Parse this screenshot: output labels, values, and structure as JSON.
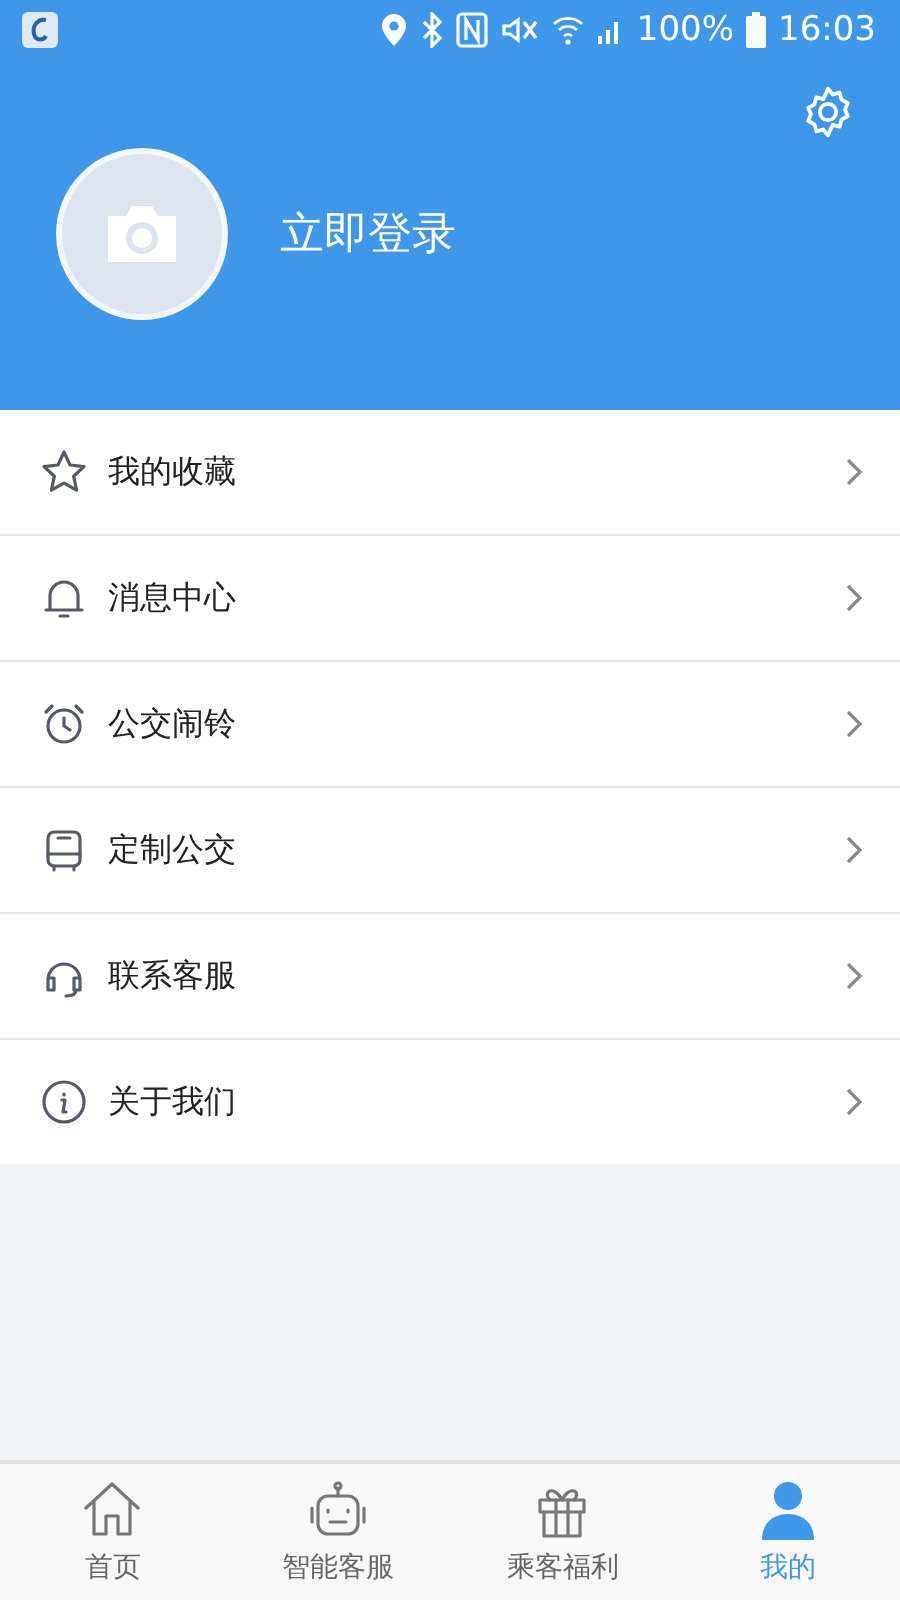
{
  "status_bar": {
    "battery": "100%",
    "time": "16:03"
  },
  "profile": {
    "login_label": "立即登录"
  },
  "menu": [
    {
      "kind": "star",
      "label": "我的收藏"
    },
    {
      "kind": "bell",
      "label": "消息中心"
    },
    {
      "kind": "alarm",
      "label": "公交闹铃"
    },
    {
      "kind": "bus",
      "label": "定制公交"
    },
    {
      "kind": "headset",
      "label": "联系客服"
    },
    {
      "kind": "info",
      "label": "关于我们"
    }
  ],
  "tabs": [
    {
      "kind": "home",
      "label": "首页",
      "selected": false
    },
    {
      "kind": "robot",
      "label": "智能客服",
      "selected": false
    },
    {
      "kind": "gift",
      "label": "乘客福利",
      "selected": false
    },
    {
      "kind": "person",
      "label": "我的",
      "selected": true
    }
  ]
}
